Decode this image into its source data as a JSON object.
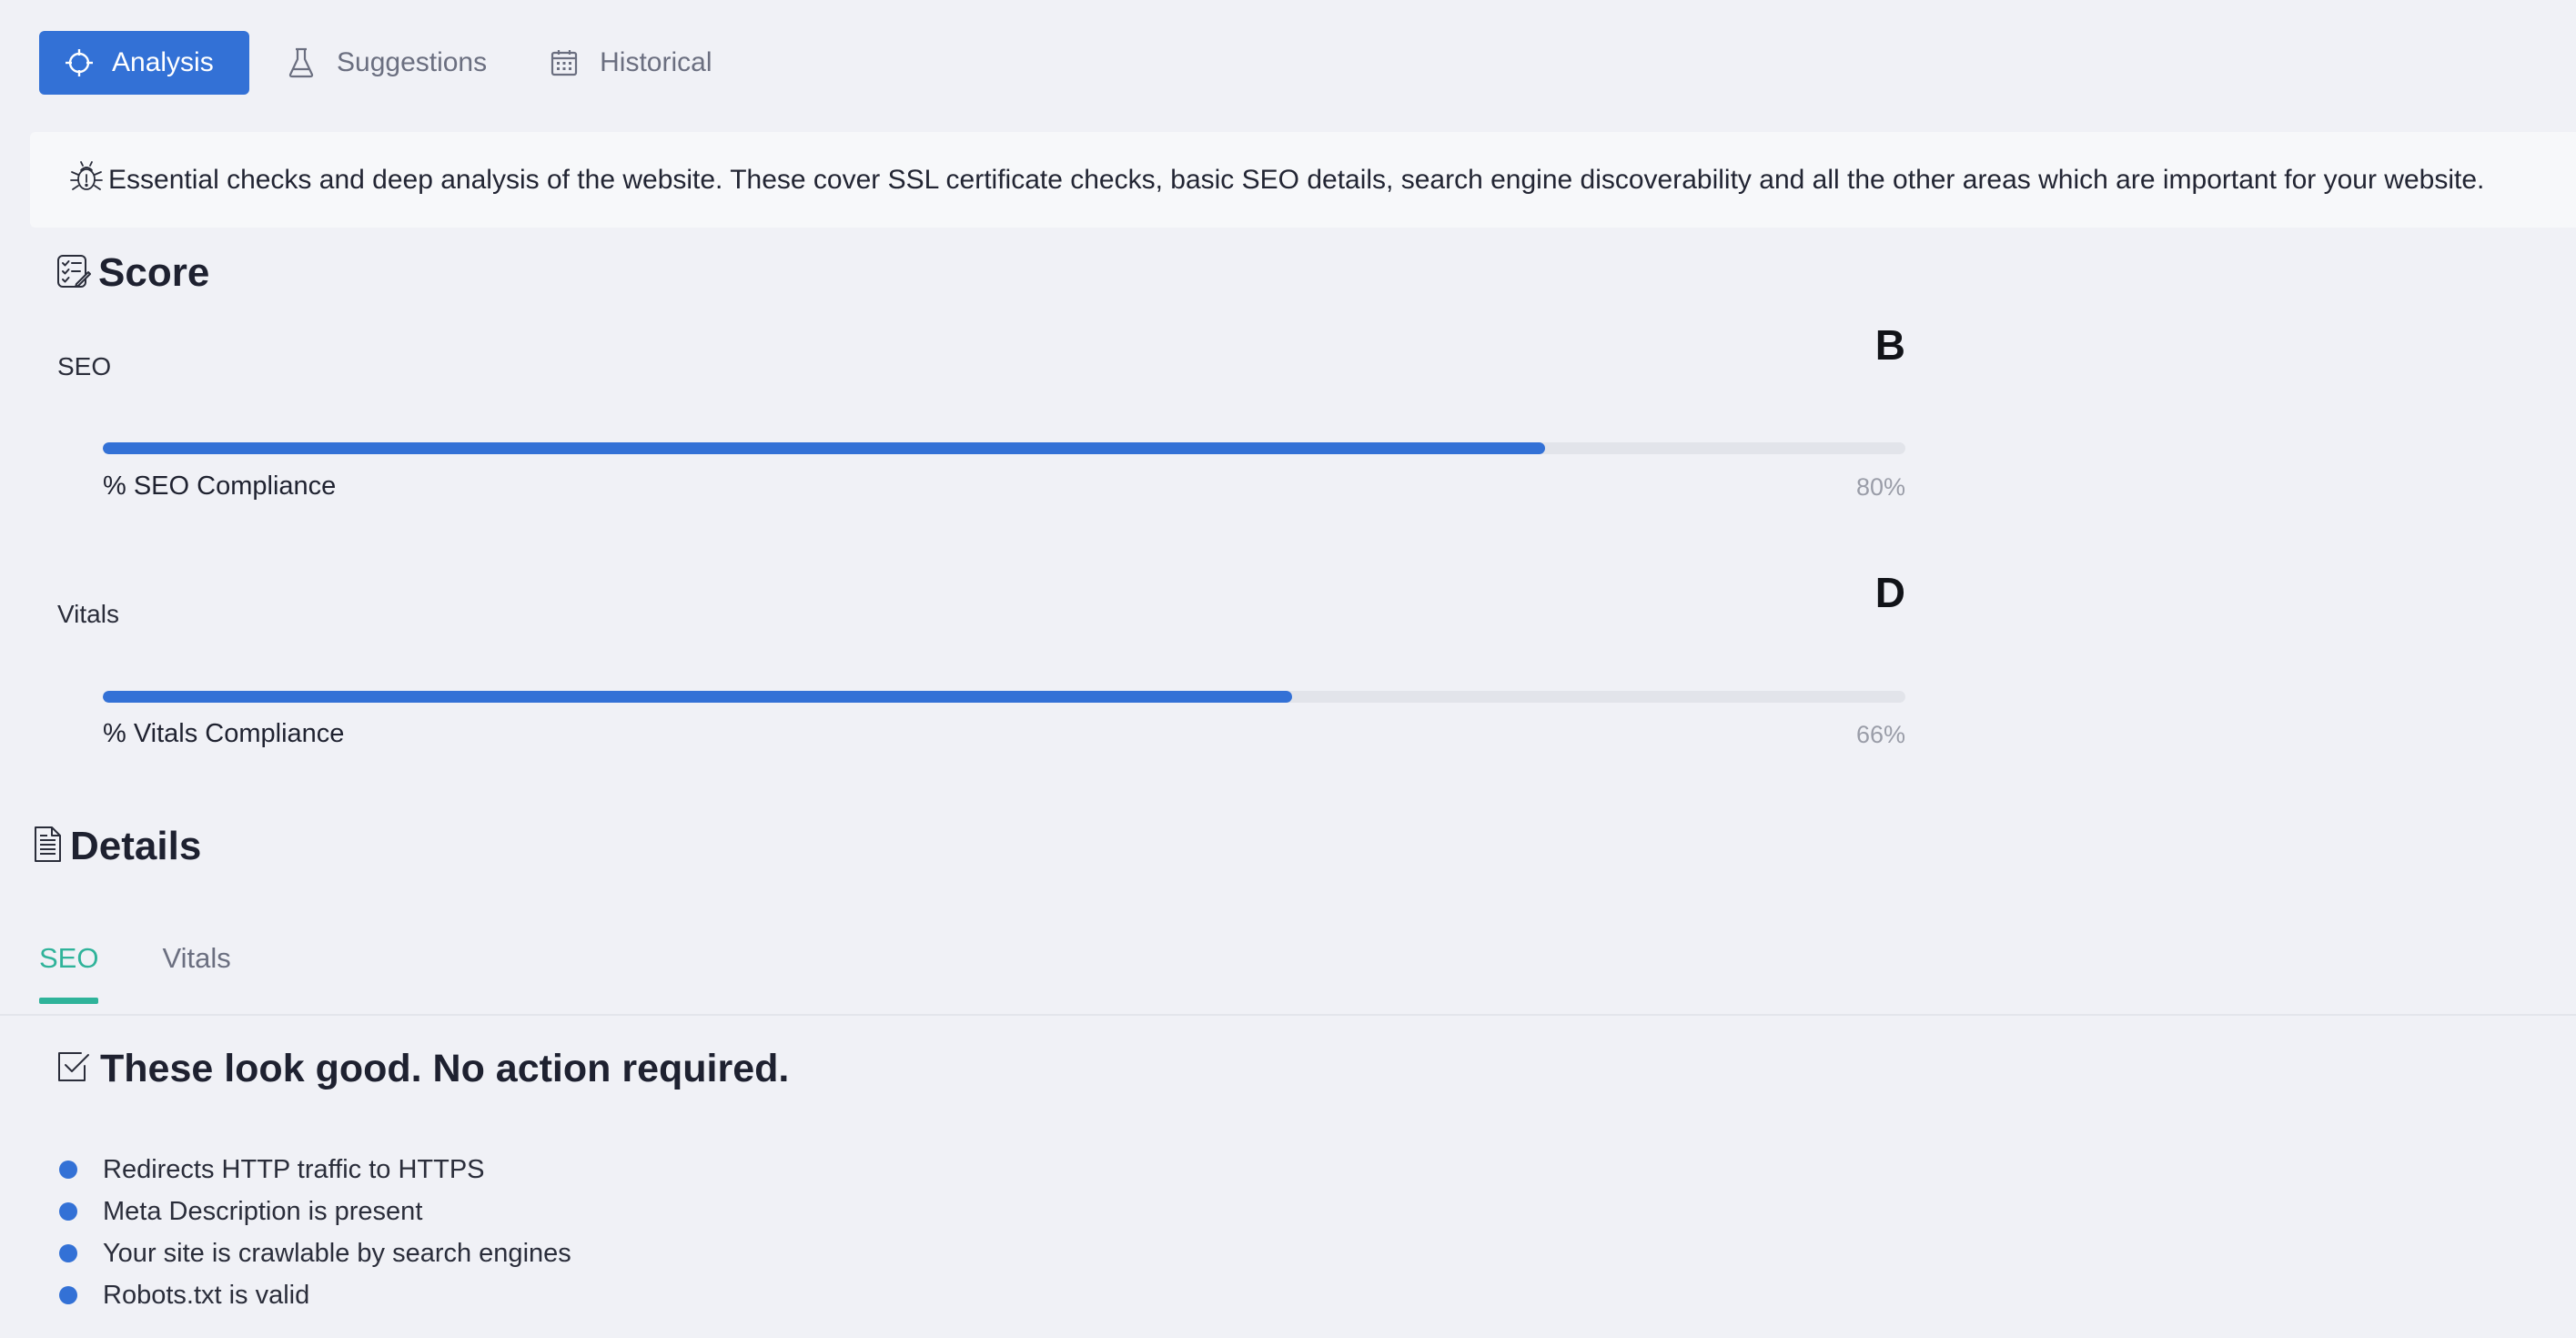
{
  "top_tabs": [
    {
      "label": "Analysis",
      "icon": "crosshair-icon",
      "active": true
    },
    {
      "label": "Suggestions",
      "icon": "flask-icon",
      "active": false
    },
    {
      "label": "Historical",
      "icon": "calendar-icon",
      "active": false
    }
  ],
  "info": {
    "icon": "bug-icon",
    "text": "Essential checks and deep analysis of the website. These cover SSL certificate checks, basic SEO details, search engine discoverability and all the other areas which are important for your website."
  },
  "score": {
    "title": "Score",
    "icon": "checklist-icon",
    "metrics": [
      {
        "label": "SEO",
        "grade": "B",
        "caption": "% SEO Compliance",
        "percent_text": "80%",
        "fill_percent": 80
      },
      {
        "label": "Vitals",
        "grade": "D",
        "caption": "% Vitals Compliance",
        "percent_text": "66%",
        "fill_percent": 66
      }
    ]
  },
  "details": {
    "title": "Details",
    "icon": "document-icon",
    "tabs": [
      {
        "label": "SEO",
        "active": true
      },
      {
        "label": "Vitals",
        "active": false
      }
    ],
    "good": {
      "title": "These look good. No action required.",
      "icon": "checkbox-icon",
      "items": [
        "Redirects HTTP traffic to HTTPS",
        "Meta Description is present",
        "Your site is crawlable by search engines",
        "Robots.txt is valid"
      ]
    }
  },
  "colors": {
    "accent": "#3371d6",
    "tab_active": "#2fb39a",
    "background": "#f0f1f6",
    "banner": "#f7f8fa",
    "track": "#e2e4ea"
  }
}
